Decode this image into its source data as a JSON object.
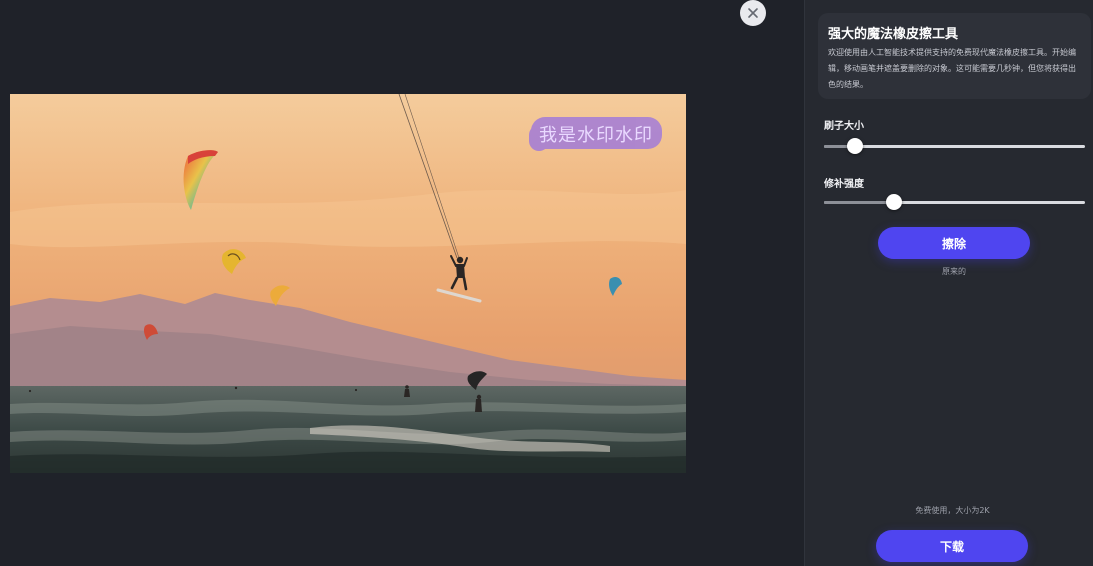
{
  "editor": {
    "watermark_text": "我是水印水印",
    "close_icon": "close-icon"
  },
  "panel": {
    "title": "强大的魔法橡皮擦工具",
    "description": "欢迎使用由人工智能技术提供支持的免费现代魔法橡皮擦工具。开始编辑，移动画笔并遮盖要删除的对象。这可能需要几秒钟，但您将获得出色的结果。",
    "brush_size": {
      "label": "刷子大小",
      "value": 0.12
    },
    "repair_strength": {
      "label": "修补强度",
      "value": 0.27
    },
    "erase_button": "擦除",
    "original_link": "原来的",
    "free_note": "免费使用，大小为2K",
    "download_button": "下载"
  },
  "colors": {
    "accent": "#4f45f0",
    "panel_bg": "#262930",
    "canvas_bg": "#1f2229",
    "watermark_highlight": "#a27bd8"
  }
}
